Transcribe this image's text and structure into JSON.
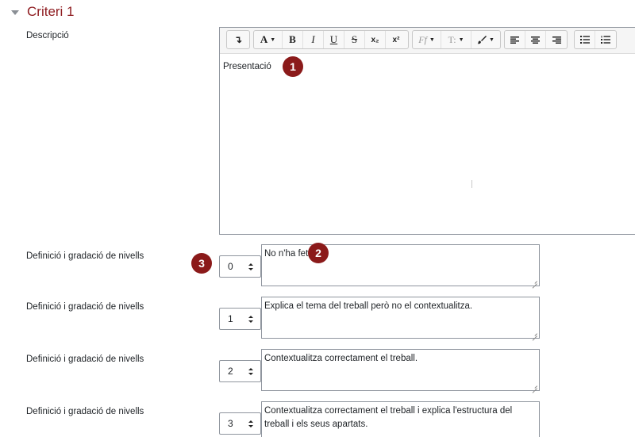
{
  "section": {
    "title": "Criteri 1"
  },
  "description": {
    "label": "Descripció",
    "content": "Presentació"
  },
  "toolbar": {
    "collapse_glyph": "↴",
    "font_color_label": "A",
    "bold_label": "B",
    "italic_label": "I",
    "underline_label": "U",
    "strike_label": "S",
    "subscript_label": "x₂",
    "superscript_label": "x²",
    "font_family_label": "Ff",
    "font_size_label": "T:",
    "brush_glyph": "🖌"
  },
  "levels": [
    {
      "label": "Definició i gradació de nivells",
      "score": "0",
      "definition": "No n'ha fet."
    },
    {
      "label": "Definició i gradació de nivells",
      "score": "1",
      "definition": "Explica el tema del treball però no el contextualitza."
    },
    {
      "label": "Definició i gradació de nivells",
      "score": "2",
      "definition": "Contextualitza correctament el treball."
    },
    {
      "label": "Definició i gradació de nivells",
      "score": "3",
      "definition": "Contextualitza correctament el treball i explica l'estructura del treball i els seus apartats."
    }
  ],
  "markers": [
    "1",
    "2",
    "3"
  ],
  "colors": {
    "title": "#8f1d21",
    "marker": "#8b1a1a"
  }
}
